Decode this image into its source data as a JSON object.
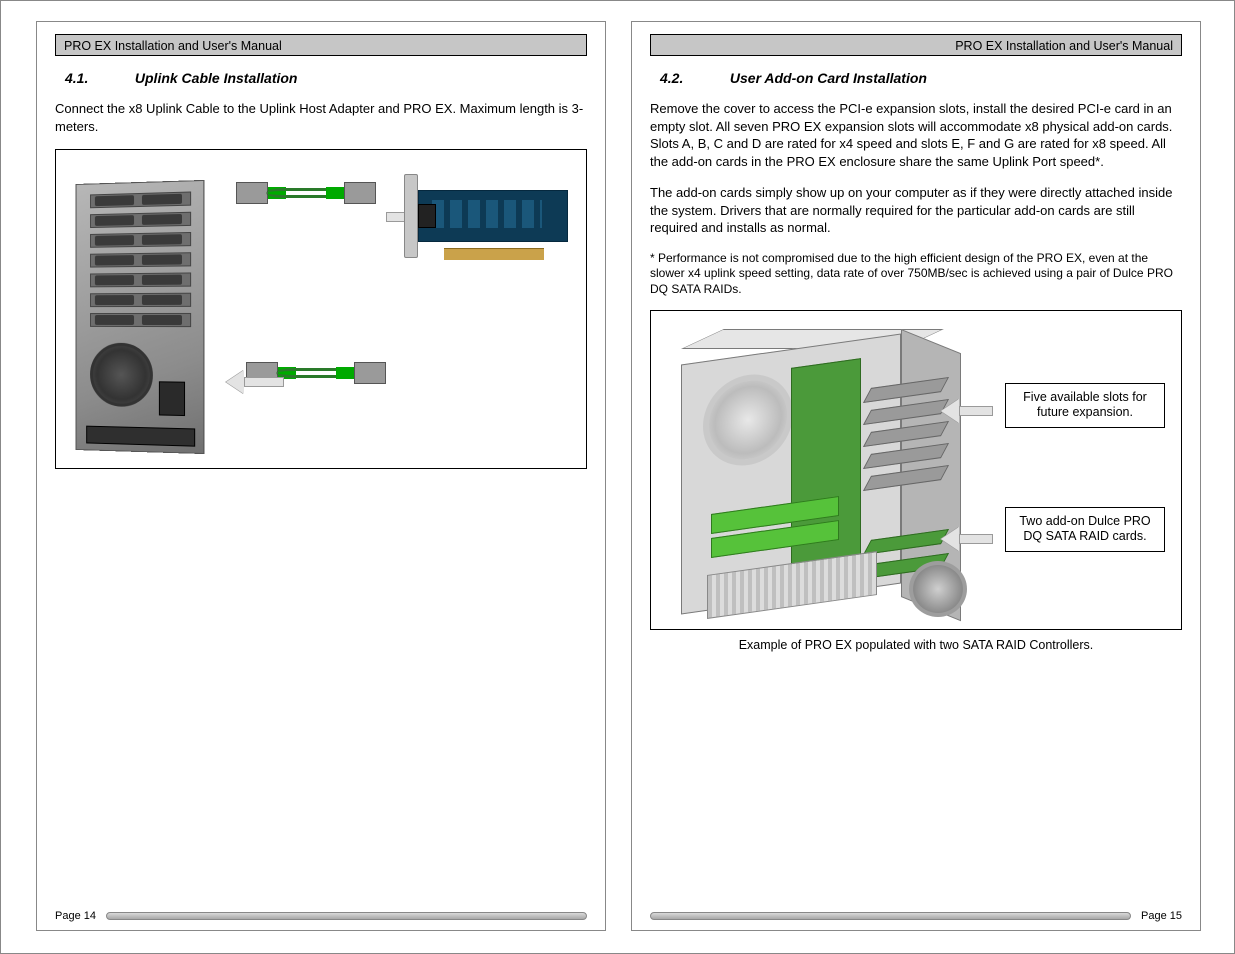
{
  "doc_title": "PRO EX Installation and User's Manual",
  "left": {
    "section_num": "4.1.",
    "section_title": "Uplink Cable Installation",
    "para1": "Connect the x8 Uplink Cable to the Uplink Host Adapter and PRO EX.  Maximum length is 3-meters.",
    "page_label": "Page 14"
  },
  "right": {
    "section_num": "4.2.",
    "section_title": "User Add-on Card Installation",
    "para1": "Remove the cover to access the PCI-e expansion slots, install the desired PCI-e card in an empty slot.  All seven PRO EX expansion slots will accommodate x8 physical add-on cards.  Slots A, B, C and D are rated for x4 speed and slots E, F and G are rated for x8 speed.  All the add-on cards in the PRO EX enclosure share the same Uplink Port speed*.",
    "para2": "The add-on cards simply show up on your computer as if they were directly attached inside the system.  Drivers that are normally required for the particular add-on cards are still required and installs as normal.",
    "footnote": "* Performance is not compromised due to the high efficient design of the PRO EX, even at the slower x4 uplink speed setting, data rate of over 750MB/sec is achieved using a pair of Dulce PRO DQ SATA RAIDs.",
    "callout1": "Five available slots for future expansion.",
    "callout2": "Two add-on Dulce PRO DQ SATA RAID cards.",
    "figure_caption": "Example of PRO EX populated with two SATA RAID Controllers.",
    "page_label": "Page 15"
  }
}
